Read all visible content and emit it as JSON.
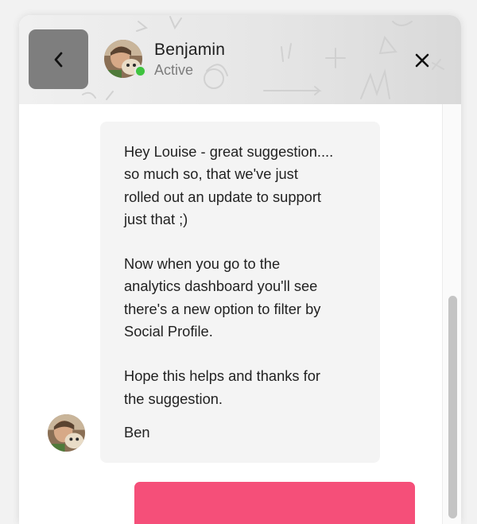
{
  "header": {
    "contact_name": "Benjamin",
    "status": "Active",
    "status_color": "#3fc33f",
    "back_icon": "chevron-left-icon",
    "close_icon": "close-icon"
  },
  "conversation": {
    "messages": [
      {
        "sender": "Benjamin",
        "direction": "incoming",
        "paragraphs": [
          "Hey Louise - great suggestion....\nso much so, that we've just\nrolled out an update to support\njust that ;)",
          "Now when you go to the\nanalytics dashboard you'll see\nthere's a new option to filter by\nSocial Profile.",
          "Hope this helps and thanks for\nthe suggestion."
        ],
        "signature": "Ben"
      },
      {
        "direction": "outgoing",
        "color": "#f54f79"
      }
    ]
  },
  "colors": {
    "accent": "#f54f79",
    "bubble_incoming": "#f4f4f4",
    "back_button": "#7e7e7e"
  }
}
